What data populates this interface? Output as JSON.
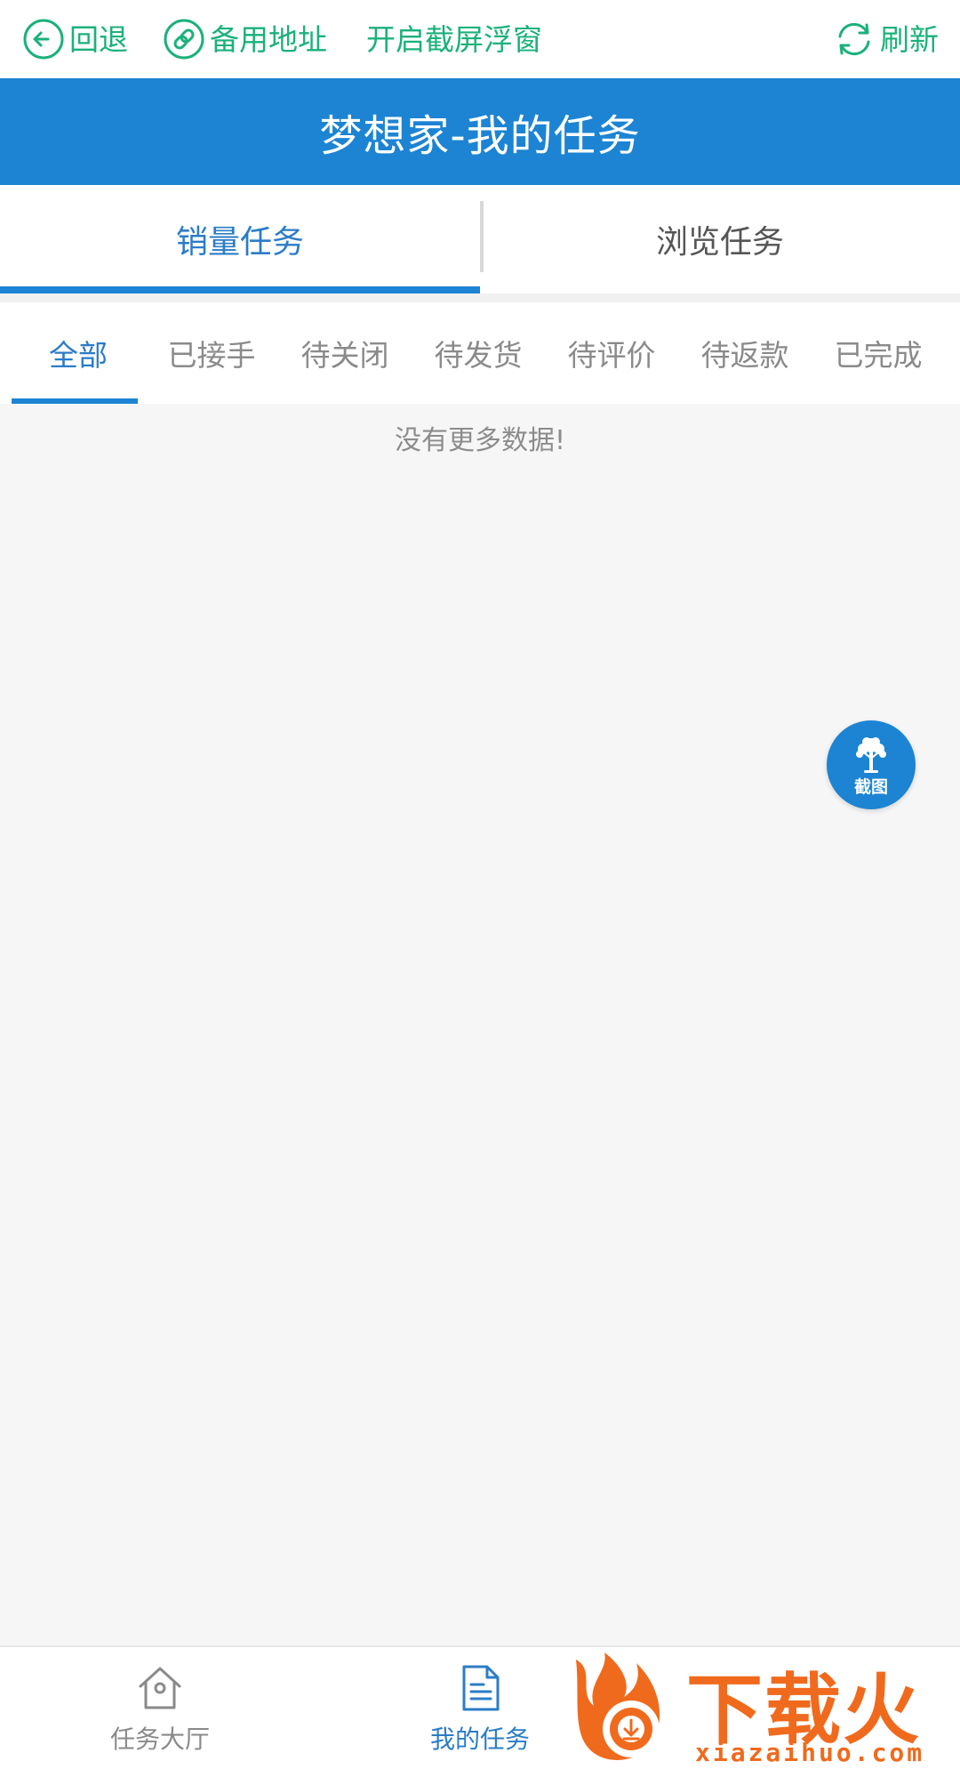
{
  "toolbar": {
    "back_label": "回退",
    "alt_address_label": "备用地址",
    "float_window_label": "开启截屏浮窗",
    "refresh_label": "刷新",
    "accent_color": "#1bb17a"
  },
  "header": {
    "title": "梦想家-我的任务",
    "background_color": "#1c84d3"
  },
  "main_tabs": [
    {
      "label": "销量任务",
      "active": true
    },
    {
      "label": "浏览任务",
      "active": false
    }
  ],
  "sub_tabs": [
    {
      "label": "全部",
      "active": true
    },
    {
      "label": "已接手",
      "active": false
    },
    {
      "label": "待关闭",
      "active": false
    },
    {
      "label": "待发货",
      "active": false
    },
    {
      "label": "待评价",
      "active": false
    },
    {
      "label": "待返款",
      "active": false
    },
    {
      "label": "已完成",
      "active": false
    }
  ],
  "content": {
    "empty_message": "没有更多数据!"
  },
  "float_button": {
    "label": "截图",
    "icon": "tree-icon"
  },
  "bottom_nav": [
    {
      "label": "任务大厅",
      "icon": "home-icon",
      "active": false
    },
    {
      "label": "我的任务",
      "icon": "document-icon",
      "active": true
    }
  ],
  "watermark": {
    "brand": "下载火",
    "url": "xiazaihuo.com",
    "color": "#f06a1d"
  }
}
